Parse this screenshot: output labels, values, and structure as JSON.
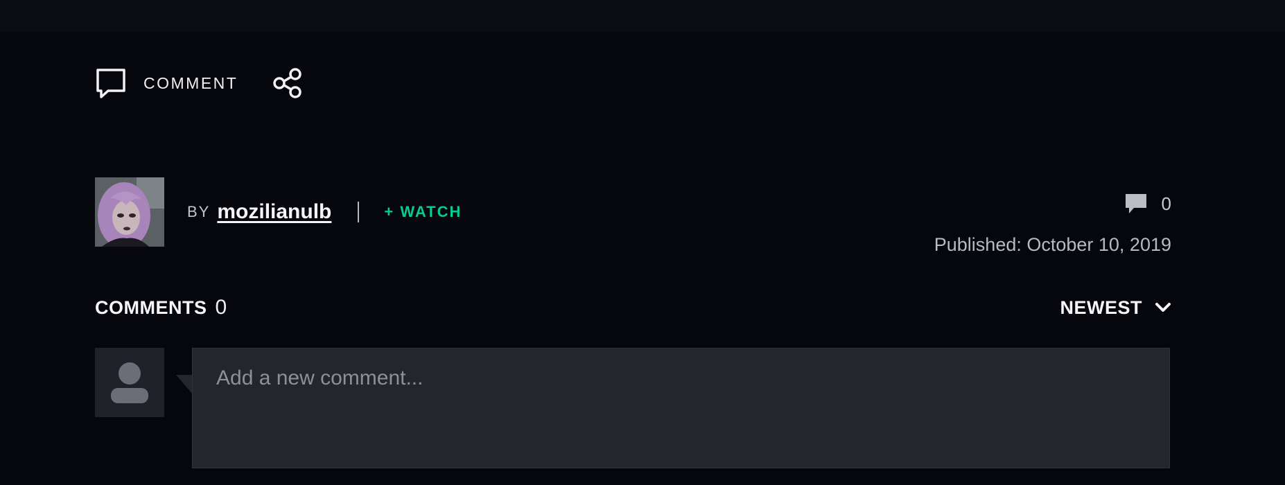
{
  "actions": {
    "comment_label": "COMMENT",
    "comment_icon": "speech-bubble-outline-icon",
    "share_icon": "share-nodes-icon"
  },
  "author": {
    "by_label": "BY",
    "name": "mozilianulb",
    "watch_label": "+ WATCH",
    "avatar": "author-portrait-avatar"
  },
  "meta": {
    "comment_count": "0",
    "published": "Published: October 10, 2019",
    "count_icon": "speech-bubble-filled-icon"
  },
  "comments": {
    "title": "COMMENTS",
    "count": "0",
    "sort_label": "NEWEST",
    "sort_icon": "chevron-down-icon",
    "input_placeholder": "Add a new comment...",
    "user_avatar": "default-user-silhouette"
  },
  "colors": {
    "background": "#06070d",
    "accent_green": "#05cc8f",
    "input_background": "#23272b"
  }
}
